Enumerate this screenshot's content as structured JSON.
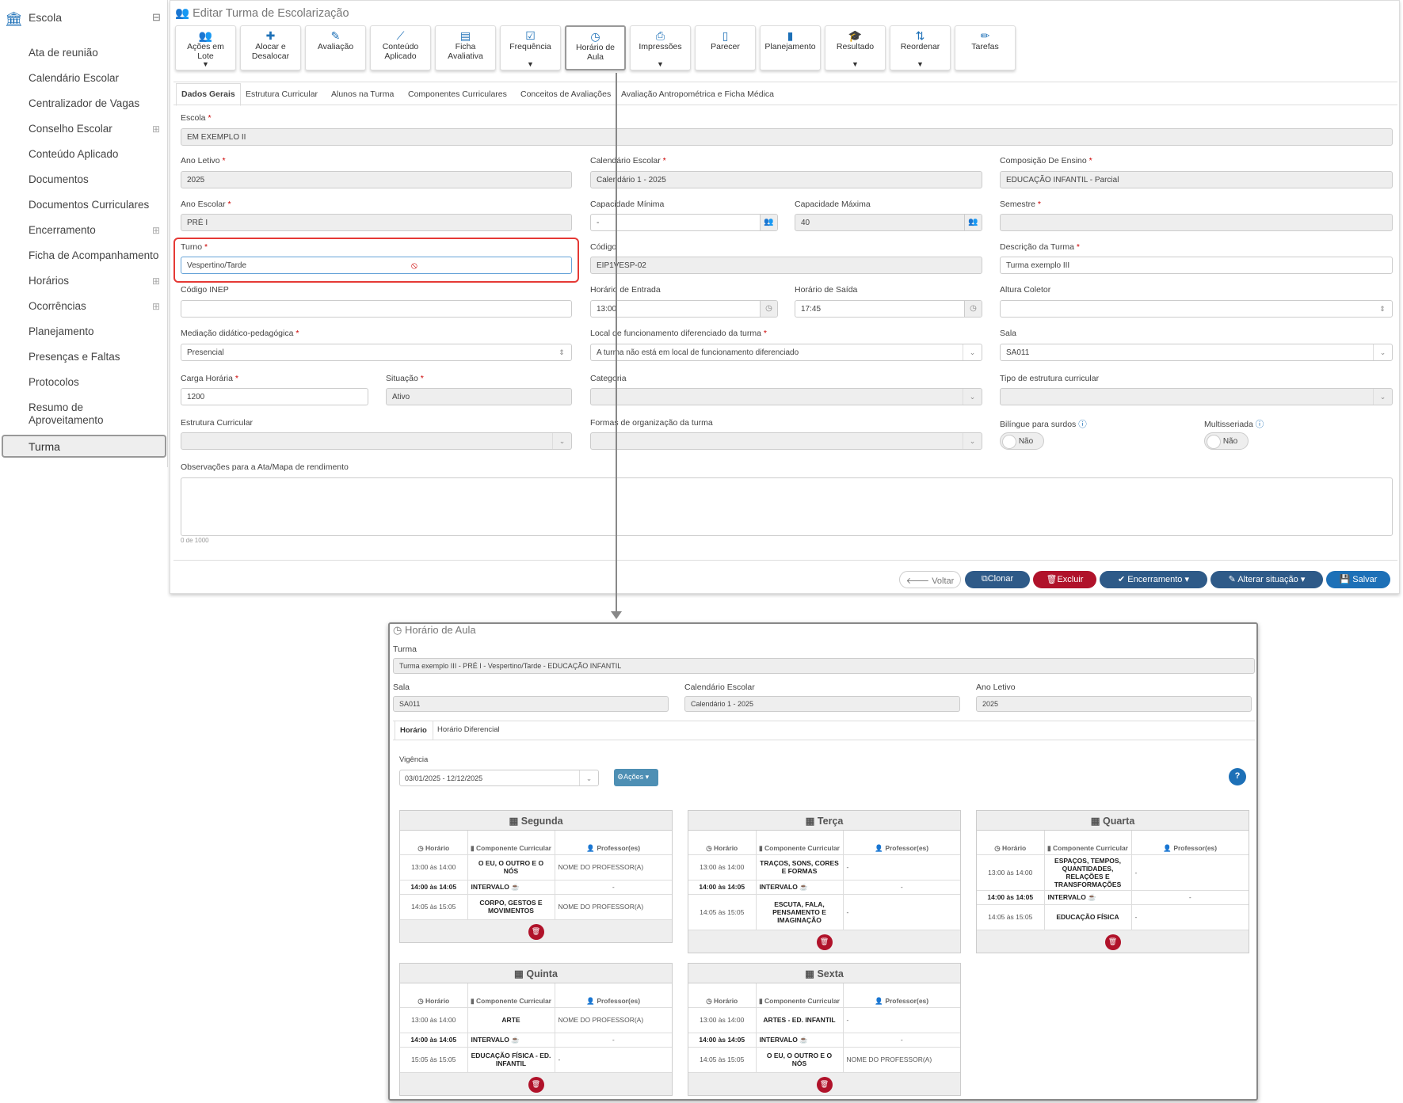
{
  "sidebar": {
    "header": "Escola",
    "items": [
      {
        "label": "Ata de reunião",
        "expand": ""
      },
      {
        "label": "Calendário Escolar",
        "expand": ""
      },
      {
        "label": "Centralizador de Vagas",
        "expand": ""
      },
      {
        "label": "Conselho Escolar",
        "expand": "⊞"
      },
      {
        "label": "Conteúdo Aplicado",
        "expand": ""
      },
      {
        "label": "Documentos",
        "expand": ""
      },
      {
        "label": "Documentos Curriculares",
        "expand": ""
      },
      {
        "label": "Encerramento",
        "expand": "⊞"
      },
      {
        "label": "Ficha de Acompanhamento",
        "expand": ""
      },
      {
        "label": "Horários",
        "expand": "⊞"
      },
      {
        "label": "Ocorrências",
        "expand": "⊞"
      },
      {
        "label": "Planejamento",
        "expand": ""
      },
      {
        "label": "Presenças e Faltas",
        "expand": ""
      },
      {
        "label": "Protocolos",
        "expand": ""
      },
      {
        "label": "Resumo de Aproveitamento",
        "expand": ""
      }
    ],
    "active": "Turma"
  },
  "page": {
    "title": "Editar Turma de Escolarização",
    "toolbar": [
      {
        "l1": "Ações em",
        "l2": "Lote",
        "icon": "users-icon",
        "caret": "▼"
      },
      {
        "l1": "Alocar e",
        "l2": "Desalocar",
        "icon": "puzzle-icon",
        "caret": ""
      },
      {
        "l1": "Avaliação",
        "l2": "",
        "icon": "edit-icon",
        "caret": ""
      },
      {
        "l1": "Conteúdo",
        "l2": "Aplicado",
        "icon": "wand-icon",
        "caret": ""
      },
      {
        "l1": "Ficha",
        "l2": "Avaliativa",
        "icon": "list-icon",
        "caret": ""
      },
      {
        "l1": "Frequência",
        "l2": "",
        "icon": "check-icon",
        "caret": "▼"
      },
      {
        "l1": "Horário de",
        "l2": "Aula",
        "icon": "clock-icon",
        "caret": ""
      },
      {
        "l1": "Impressões",
        "l2": "",
        "icon": "print-icon",
        "caret": "▼"
      },
      {
        "l1": "Parecer",
        "l2": "",
        "icon": "file-icon",
        "caret": ""
      },
      {
        "l1": "Planejamento",
        "l2": "",
        "icon": "book-icon",
        "caret": ""
      },
      {
        "l1": "Resultado",
        "l2": "",
        "icon": "cap-icon",
        "caret": "▼"
      },
      {
        "l1": "Reordenar",
        "l2": "",
        "icon": "sort-icon",
        "caret": "▼"
      },
      {
        "l1": "Tarefas",
        "l2": "",
        "icon": "pencil-icon",
        "caret": ""
      }
    ],
    "tabs": [
      "Dados Gerais",
      "Estrutura Curricular",
      "Alunos na Turma",
      "Componentes Curriculares",
      "Conceitos de Avaliações",
      "Avaliação Antropométrica e Ficha Médica"
    ]
  },
  "form": {
    "escola": {
      "label": "Escola",
      "value": "EM EXEMPLO II"
    },
    "ano_letivo": {
      "label": "Ano Letivo",
      "value": "2025"
    },
    "calendario": {
      "label": "Calendário Escolar",
      "value": "Calendário 1 - 2025"
    },
    "composicao": {
      "label": "Composição De Ensino",
      "value": "EDUCAÇÃO INFANTIL - Parcial"
    },
    "ano_escolar": {
      "label": "Ano Escolar",
      "value": "PRÉ I"
    },
    "cap_min": {
      "label": "Capacidade Mínima",
      "value": "-"
    },
    "cap_max": {
      "label": "Capacidade Máxima",
      "value": "40"
    },
    "semestre": {
      "label": "Semestre",
      "value": ""
    },
    "turno": {
      "label": "Turno",
      "value": "Vespertino/Tarde"
    },
    "codigo": {
      "label": "Código",
      "value": "EIP1VESP-02"
    },
    "descricao": {
      "label": "Descrição da Turma",
      "value": "Turma exemplo III"
    },
    "inep": {
      "label": "Código INEP",
      "value": ""
    },
    "h_entrada": {
      "label": "Horário de Entrada",
      "value": "13:00"
    },
    "h_saida": {
      "label": "Horário de Saída",
      "value": "17:45"
    },
    "altura": {
      "label": "Altura Coletor",
      "value": ""
    },
    "mediacao": {
      "label": "Mediação didático-pedagógica",
      "value": "Presencial"
    },
    "local": {
      "label": "Local de funcionamento diferenciado da turma",
      "value": "A turma não está em local de funcionamento diferenciado"
    },
    "sala": {
      "label": "Sala",
      "value": "SA011"
    },
    "carga": {
      "label": "Carga Horária",
      "value": "1200"
    },
    "situacao": {
      "label": "Situação",
      "value": "Ativo"
    },
    "categoria": {
      "label": "Categoria",
      "value": ""
    },
    "tipo_estrutura": {
      "label": "Tipo de estrutura curricular",
      "value": ""
    },
    "estrutura": {
      "label": "Estrutura Curricular",
      "value": ""
    },
    "formas": {
      "label": "Formas de organização da turma",
      "value": ""
    },
    "bilingue": {
      "label": "Bilíngue para surdos",
      "value": "Não"
    },
    "multisseriada": {
      "label": "Multisseriada",
      "value": "Não"
    },
    "observacoes": {
      "label": "Observações para a Ata/Mapa de rendimento",
      "counter": "0 de 1000"
    }
  },
  "buttons": {
    "voltar": "Voltar",
    "clonar": "Clonar",
    "excluir": "Excluir",
    "encerramento": "Encerramento",
    "alterar": "Alterar situação",
    "salvar": "Salvar"
  },
  "popup": {
    "title": "Horário de Aula",
    "turma_label": "Turma",
    "turma_value": "Turma exemplo III - PRÉ I - Vespertino/Tarde - EDUCAÇÃO INFANTIL",
    "sala_label": "Sala",
    "sala_value": "SA011",
    "cal_label": "Calendário Escolar",
    "cal_value": "Calendário 1 - 2025",
    "ano_label": "Ano Letivo",
    "ano_value": "2025",
    "tabs": [
      "Horário",
      "Horário Diferencial"
    ],
    "vigencia_label": "Vigência",
    "vigencia_value": "03/01/2025 - 12/12/2025",
    "acoes": "Ações",
    "col_horario": "Horário",
    "col_componente": "Componente Curricular",
    "col_professor": "Professor(es)",
    "days": [
      {
        "name": "Segunda",
        "rows": [
          {
            "h": "13:00 às 14:00",
            "c": "O EU, O OUTRO E O NÓS",
            "p": "NOME DO PROFESSOR(A)",
            "b": false
          },
          {
            "h": "14:00 às 14:05",
            "c": "INTERVALO",
            "p": "-",
            "b": true
          },
          {
            "h": "14:05 às 15:05",
            "c": "CORPO, GESTOS E MOVIMENTOS",
            "p": "NOME DO PROFESSOR(A)",
            "b": false
          }
        ]
      },
      {
        "name": "Terça",
        "rows": [
          {
            "h": "13:00 às 14:00",
            "c": "TRAÇOS, SONS, CORES E FORMAS",
            "p": "-",
            "b": false
          },
          {
            "h": "14:00 às 14:05",
            "c": "INTERVALO",
            "p": "-",
            "b": true
          },
          {
            "h": "14:05 às 15:05",
            "c": "ESCUTA, FALA, PENSAMENTO E IMAGINAÇÃO",
            "p": "-",
            "b": false
          }
        ]
      },
      {
        "name": "Quarta",
        "rows": [
          {
            "h": "13:00 às 14:00",
            "c": "ESPAÇOS, TEMPOS, QUANTIDADES, RELAÇÕES E TRANSFORMAÇÕES",
            "p": "-",
            "b": false
          },
          {
            "h": "14:00 às 14:05",
            "c": "INTERVALO",
            "p": "-",
            "b": true
          },
          {
            "h": "14:05 às 15:05",
            "c": "EDUCAÇÃO FÍSICA",
            "p": "-",
            "b": false
          }
        ]
      },
      {
        "name": "Quinta",
        "rows": [
          {
            "h": "13:00 às 14:00",
            "c": "ARTE",
            "p": "NOME DO PROFESSOR(A)",
            "b": false
          },
          {
            "h": "14:00 às 14:05",
            "c": "INTERVALO",
            "p": "-",
            "b": true
          },
          {
            "h": "15:05 às 15:05",
            "c": "EDUCAÇÃO FÍSICA - ED. INFANTIL",
            "p": "-",
            "b": false
          }
        ]
      },
      {
        "name": "Sexta",
        "rows": [
          {
            "h": "13:00 às 14:00",
            "c": "ARTES - ED. INFANTIL",
            "p": "-",
            "b": false
          },
          {
            "h": "14:00 às 14:05",
            "c": "INTERVALO",
            "p": "-",
            "b": true
          },
          {
            "h": "14:05 às 15:05",
            "c": "O EU, O OUTRO E O NÓS",
            "p": "NOME DO PROFESSOR(A)",
            "b": false
          }
        ]
      }
    ]
  },
  "colors": {
    "primary": "#1d70b7",
    "danger": "#b0122a",
    "dark": "#2e5a88",
    "highlight": "#e53935"
  }
}
